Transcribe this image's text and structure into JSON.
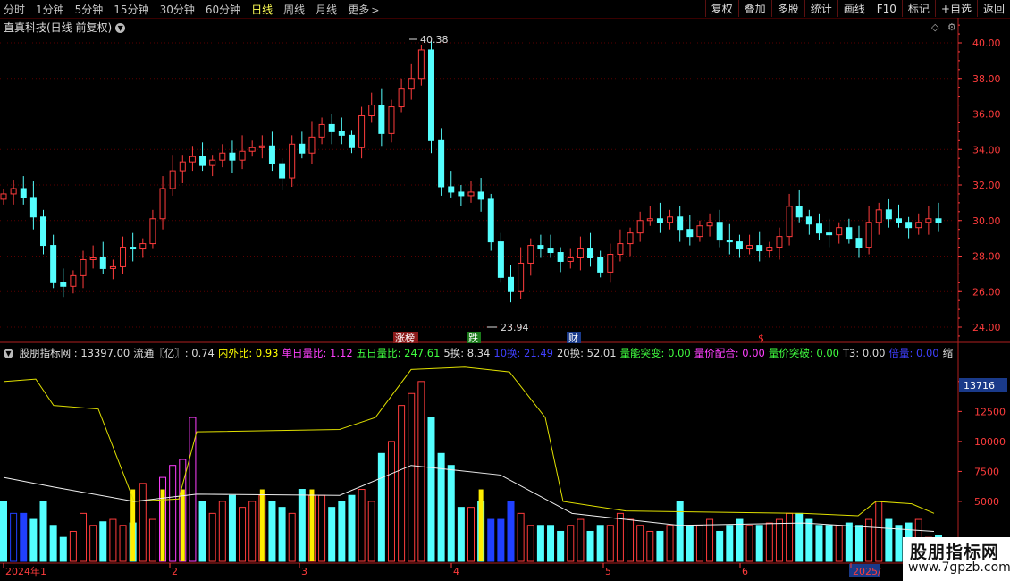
{
  "toolbar": {
    "periods": [
      "分时",
      "1分钟",
      "5分钟",
      "15分钟",
      "30分钟",
      "60分钟",
      "日线",
      "周线",
      "月线",
      "更多"
    ],
    "active_index": 6,
    "more_chevron": ">",
    "right_buttons": [
      "复权",
      "叠加",
      "多股",
      "统计",
      "画线",
      "F10",
      "标记",
      "+自选",
      "返回"
    ]
  },
  "main_chart": {
    "title": "直真科技(日线 前复权)",
    "dropdown_icon": "chevron-down-icon",
    "y_ticks": [
      "40.00",
      "38.00",
      "36.00",
      "34.00",
      "32.00",
      "30.00",
      "28.00",
      "26.00",
      "24.00"
    ],
    "max_label": "40.38",
    "min_label": "23.94",
    "events": [
      {
        "label": "涨榜",
        "color": "#ffffff",
        "bg": "#8b1a1a"
      },
      {
        "label": "跌",
        "color": "#ffffff",
        "bg": "#1a7a1a"
      },
      {
        "label": "财",
        "color": "#ffffff",
        "bg": "#1a3a8a"
      },
      {
        "label": "$",
        "color": "#ff3030",
        "bg": "none"
      }
    ]
  },
  "indicator": {
    "name": "股朋指标网",
    "items": [
      {
        "label": "股朋指标网 : 13397.00",
        "color": "#dcdcdc"
      },
      {
        "label": "流通〖亿〗: 0.74",
        "color": "#dcdcdc"
      },
      {
        "label": "内外比: 0.93",
        "color": "#ffff00"
      },
      {
        "label": "单日量比: 1.12",
        "color": "#ff40ff"
      },
      {
        "label": "五日量比: 247.61",
        "color": "#40ff40"
      },
      {
        "label": "5换: 8.34",
        "color": "#dcdcdc"
      },
      {
        "label": "10换: 21.49",
        "color": "#4040ff"
      },
      {
        "label": "20换: 52.01",
        "color": "#dcdcdc"
      },
      {
        "label": "量能突变: 0.00",
        "color": "#40ff40"
      },
      {
        "label": "量价配合: 0.00",
        "color": "#ff40ff"
      },
      {
        "label": "量价突破: 0.00",
        "color": "#40ff40"
      },
      {
        "label": "T3: 0.00",
        "color": "#dcdcdc"
      },
      {
        "label": "倍量: 0.00",
        "color": "#4040ff"
      },
      {
        "label": "缩",
        "color": "#dcdcdc"
      }
    ],
    "y_ticks": [
      "15000",
      "12500",
      "10000",
      "7500",
      "5000"
    ],
    "current_badge": "13716"
  },
  "x_axis": {
    "labels": [
      "2024年1",
      "2",
      "3",
      "4",
      "5",
      "6",
      "2025/"
    ]
  },
  "watermark": {
    "line1": "股朋指标网",
    "line2": "www.7gpzb.com"
  },
  "colors": {
    "up": "#ff3c3c",
    "down": "#54ffff",
    "grid": "#5a0000",
    "axis_text": "#ff3c3c"
  },
  "chart_data": {
    "type": "candlestick",
    "ylim": [
      23.5,
      41
    ],
    "candles_close_approx": [
      31.5,
      31.8,
      31.3,
      30.2,
      28.6,
      26.5,
      26.3,
      26.9,
      27.8,
      27.9,
      27.3,
      27.4,
      28.5,
      28.4,
      28.7,
      30.1,
      31.8,
      32.8,
      33.3,
      33.6,
      33.1,
      33.4,
      33.8,
      33.4,
      33.9,
      34.1,
      34.2,
      33.2,
      32.4,
      34.3,
      33.8,
      34.7,
      35.4,
      35.0,
      34.8,
      34.1,
      35.9,
      36.5,
      34.9,
      36.4,
      37.4,
      38.0,
      39.6,
      34.5,
      31.9,
      31.6,
      31.4,
      31.6,
      31.2,
      28.8,
      26.8,
      26.0,
      27.6,
      28.6,
      28.4,
      28.2,
      27.7,
      27.9,
      28.4,
      27.9,
      27.1,
      28.1,
      28.7,
      29.3,
      30.0,
      30.1,
      29.9,
      30.2,
      29.5,
      29.1,
      29.7,
      29.9,
      28.9,
      28.8,
      28.4,
      28.6,
      28.3,
      28.5,
      29.1,
      30.8,
      30.2,
      29.8,
      29.3,
      29.2,
      29.6,
      29.0,
      28.5,
      29.9,
      30.6,
      30.1,
      29.9,
      29.6,
      29.9,
      30.1,
      29.9
    ]
  }
}
